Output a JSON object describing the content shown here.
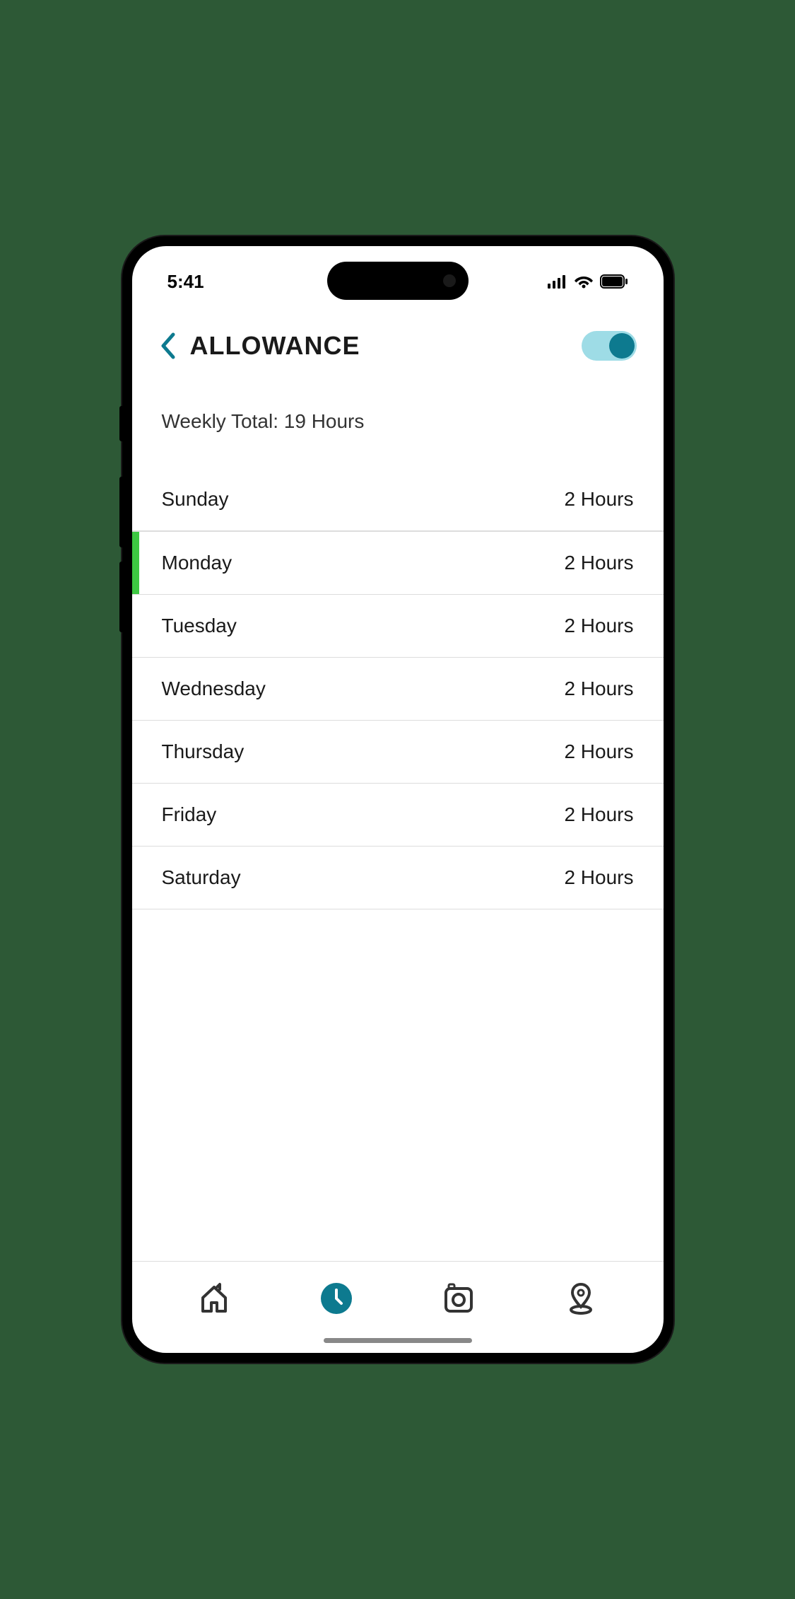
{
  "status": {
    "time": "5:41"
  },
  "header": {
    "title": "ALLOWANCE",
    "toggle_on": true
  },
  "summary": {
    "weekly_total_label": "Weekly Total: 19 Hours"
  },
  "days": [
    {
      "name": "Sunday",
      "value": "2 Hours",
      "active": false
    },
    {
      "name": "Monday",
      "value": "2 Hours",
      "active": true
    },
    {
      "name": "Tuesday",
      "value": "2 Hours",
      "active": false
    },
    {
      "name": "Wednesday",
      "value": "2 Hours",
      "active": false
    },
    {
      "name": "Thursday",
      "value": "2 Hours",
      "active": false
    },
    {
      "name": "Friday",
      "value": "2 Hours",
      "active": false
    },
    {
      "name": "Saturday",
      "value": "2 Hours",
      "active": false
    }
  ],
  "nav": {
    "home": "home-icon",
    "time": "clock-icon",
    "camera": "camera-icon",
    "location": "location-icon",
    "active": "time"
  }
}
